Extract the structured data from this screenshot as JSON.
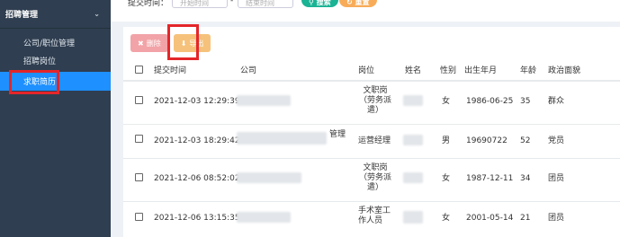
{
  "sidebar": {
    "group_label": "招聘管理",
    "items": [
      {
        "label": "公司/职位管理"
      },
      {
        "label": "招聘岗位"
      },
      {
        "label": "求职简历"
      }
    ]
  },
  "filter": {
    "label": "提交时间：",
    "start_placeholder": "开始时间",
    "end_placeholder": "结束时间",
    "separator": "-",
    "search_label": "搜索",
    "reset_label": "重置"
  },
  "toolbar": {
    "delete_label": "删除",
    "export_label": "导出"
  },
  "table": {
    "headers": {
      "time": "提交时间",
      "company": "公司",
      "position": "岗位",
      "name": "姓名",
      "gender": "性别",
      "birth": "出生年月",
      "age": "年龄",
      "politics": "政治面貌"
    },
    "rows": [
      {
        "time": "2021-12-03 12:29:39",
        "position_lines": [
          "文职岗",
          "（劳务派",
          "遣）"
        ],
        "gender": "女",
        "birth": "1986-06-25",
        "age": "35",
        "politics": "群众"
      },
      {
        "time": "2021-12-03 18:29:42",
        "company_suffix": "管理",
        "position_lines": [
          "运营经理"
        ],
        "gender": "男",
        "birth": "19690722",
        "age": "52",
        "politics": "党员"
      },
      {
        "time": "2021-12-06 08:52:02",
        "position_lines": [
          "文职岗",
          "（劳务派",
          "遣）"
        ],
        "gender": "女",
        "birth": "1987-12-11",
        "age": "34",
        "politics": "团员"
      },
      {
        "time": "2021-12-06 13:15:35",
        "position_lines": [
          "手术室工",
          "作人员"
        ],
        "gender": "女",
        "birth": "2001-05-14",
        "age": "21",
        "politics": "团员"
      }
    ]
  },
  "colors": {
    "sidebar_bg": "#2f3e50",
    "active_item": "#1e90ff",
    "search_btn": "#1ab394",
    "reset_btn": "#f8ac59",
    "annotation": "#e4262a"
  }
}
